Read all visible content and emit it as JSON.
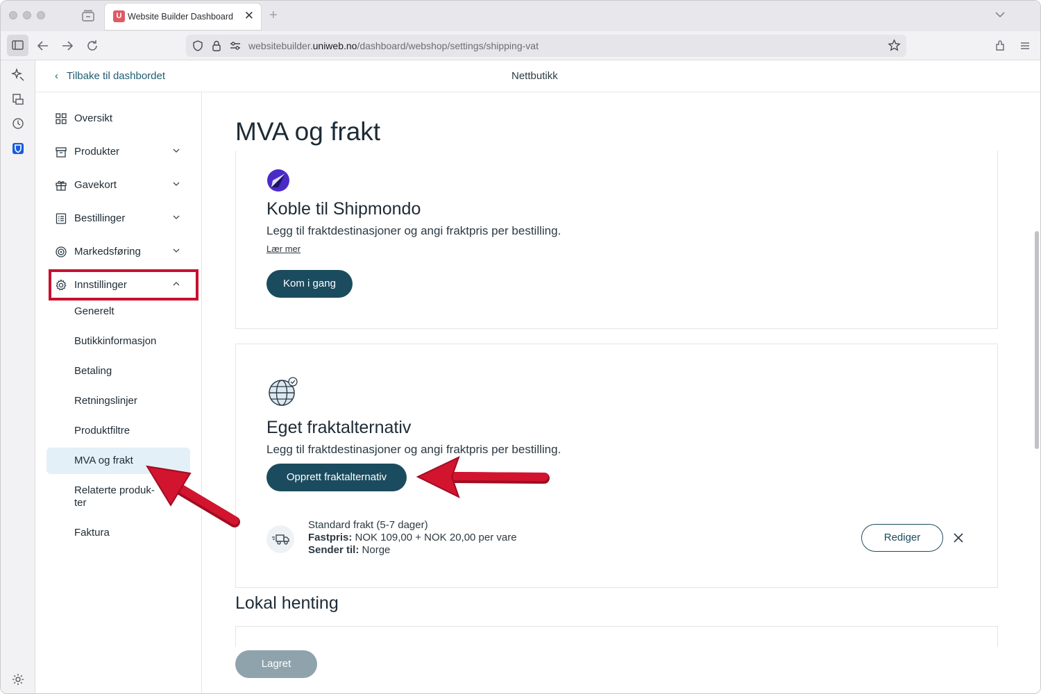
{
  "browser": {
    "tab_title": "Website Builder Dashboard",
    "favicon_letter": "U",
    "url_prefix": "websitebuilder.",
    "url_domain": "uniweb.no",
    "url_path": "/dashboard/webshop/settings/shipping-vat"
  },
  "header": {
    "back_label": "Tilbake til dashbordet",
    "title": "Nettbutikk"
  },
  "nav": {
    "items": [
      {
        "label": "Oversikt",
        "icon": "grid-icon"
      },
      {
        "label": "Produkter",
        "icon": "archive-icon"
      },
      {
        "label": "Gavekort",
        "icon": "gift-icon"
      },
      {
        "label": "Bestillinger",
        "icon": "list-icon"
      },
      {
        "label": "Markedsføring",
        "icon": "target-icon"
      },
      {
        "label": "Innstillinger",
        "icon": "gear-icon"
      }
    ],
    "settings_sub": [
      "Generelt",
      "Butikkinformasjon",
      "Betaling",
      "Retningslinjer",
      "Produktfiltre",
      "MVA og frakt",
      "Relaterte produk-",
      "ter",
      "Faktura"
    ]
  },
  "main": {
    "title": "MVA og frakt",
    "shipmondo": {
      "heading": "Koble til Shipmondo",
      "desc": "Legg til fraktdestinasjoner og angi fraktpris per bestilling.",
      "learn_more": "Lær mer",
      "button": "Kom i gang"
    },
    "custom": {
      "heading": "Eget fraktalternativ",
      "desc": "Legg til fraktdestinasjoner og angi fraktpris per bestilling.",
      "button": "Opprett fraktalternativ",
      "option": {
        "name": "Standard frakt (5-7 dager)",
        "price_label": "Fastpris:",
        "price_value": "NOK 109,00 + NOK 20,00 per vare",
        "dest_label": "Sender til:",
        "dest_value": "Norge",
        "edit_button": "Rediger"
      }
    },
    "pickup_heading": "Lokal henting",
    "saved_button": "Lagret"
  },
  "colors": {
    "accent": "#1b4b5e",
    "annotation_red": "#c8102e",
    "active_bg": "#e4f0f8"
  }
}
